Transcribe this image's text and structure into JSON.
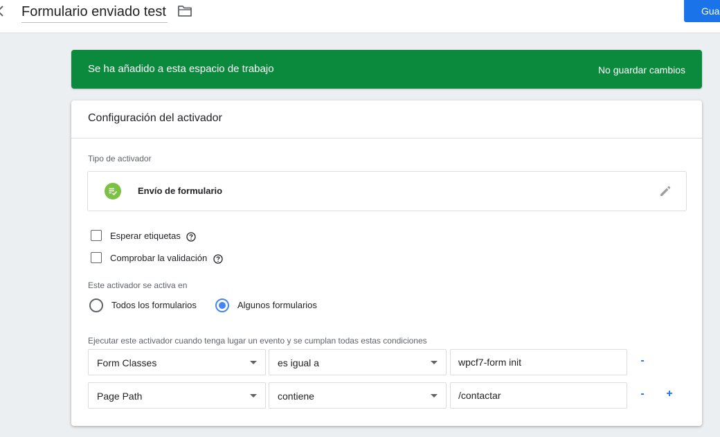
{
  "header": {
    "title": "Formulario enviado test",
    "save_label": "Guardar"
  },
  "banner": {
    "message": "Se ha añadido a esta espacio de trabajo",
    "action": "No guardar cambios"
  },
  "card": {
    "title": "Configuración del activador",
    "trigger_type_label": "Tipo de activador",
    "trigger_type": "Envío de formulario",
    "options": [
      {
        "label": "Esperar etiquetas",
        "checked": false
      },
      {
        "label": "Comprobar la validación",
        "checked": false
      }
    ],
    "fires_on_label": "Este activador se activa en",
    "fires_on_options": [
      {
        "label": "Todos los formularios",
        "selected": false
      },
      {
        "label": "Algunos formularios",
        "selected": true
      }
    ],
    "conditions_label": "Ejecutar este activador cuando tenga lugar un evento y se cumplan todas estas condiciones",
    "conditions": [
      {
        "variable": "Form Classes",
        "operator": "es igual a",
        "value": "wpcf7-form init",
        "remove": "-"
      },
      {
        "variable": "Page Path",
        "operator": "contiene",
        "value": "/contactar",
        "remove": "-",
        "add": "+"
      }
    ]
  },
  "colors": {
    "banner_bg": "#0b8a3e",
    "accent": "#1a73e8",
    "radio_selected": "#4285f4",
    "trigger_icon": "#7cc242"
  },
  "icons": [
    "back-icon",
    "folder-icon",
    "form-submit-icon",
    "pencil-icon",
    "help-icon"
  ]
}
